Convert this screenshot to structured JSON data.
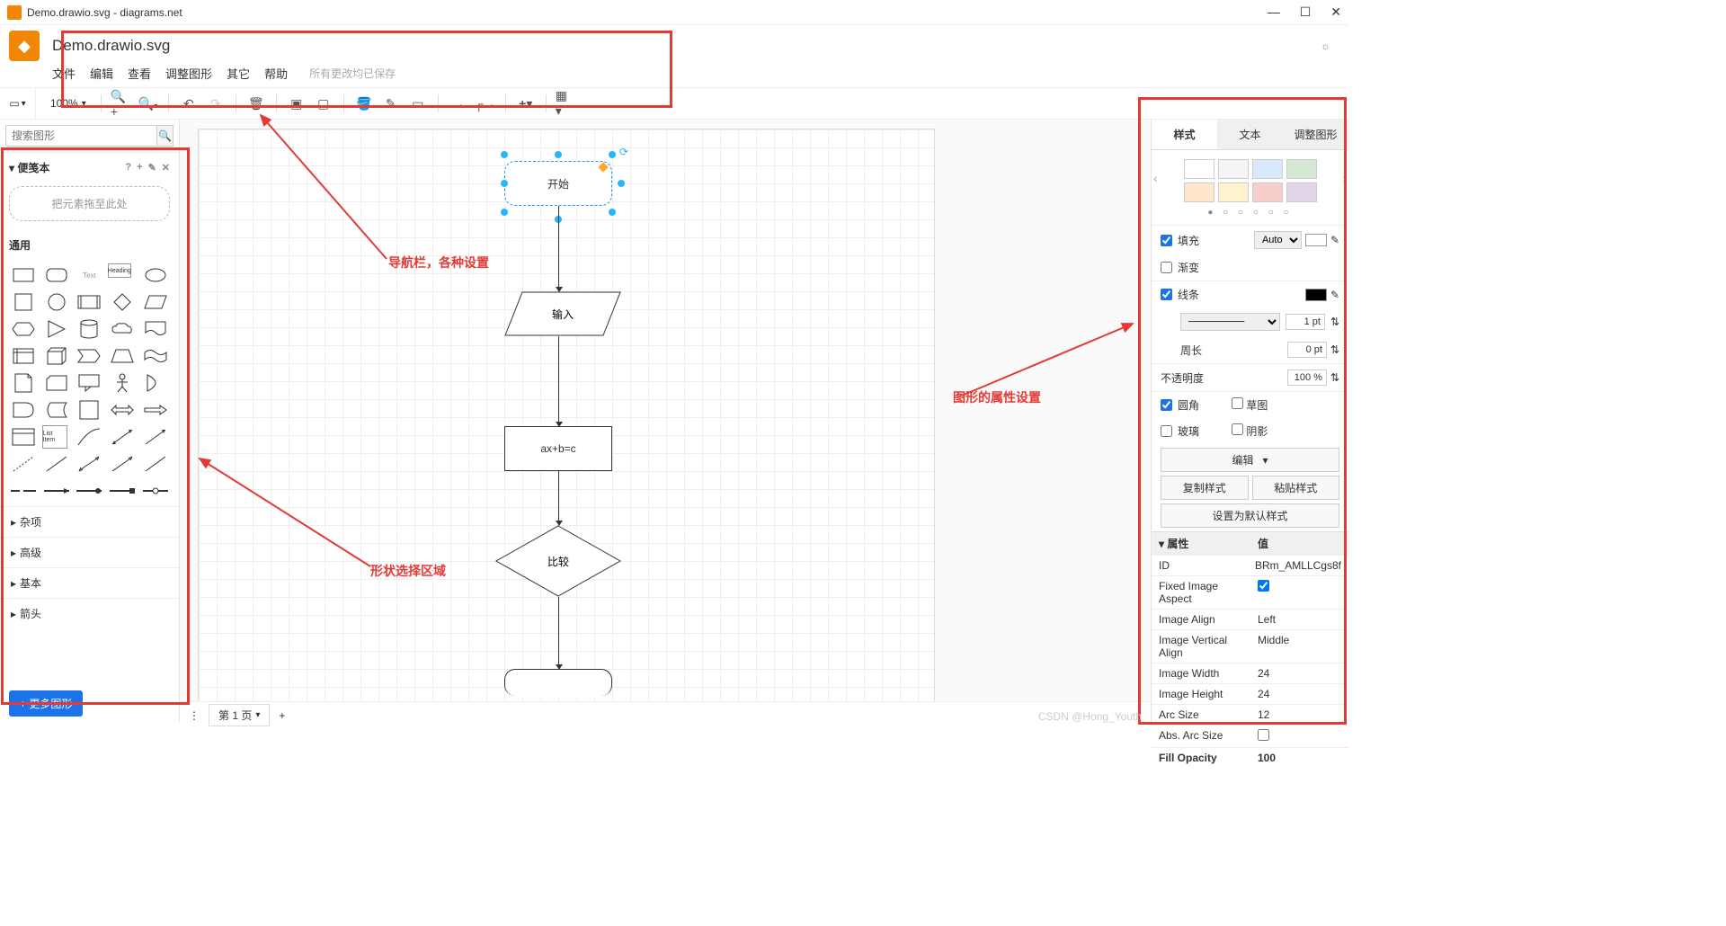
{
  "window": {
    "title": "Demo.drawio.svg - diagrams.net"
  },
  "header": {
    "filename": "Demo.drawio.svg"
  },
  "menu": {
    "file": "文件",
    "edit": "编辑",
    "view": "查看",
    "arrange": "调整图形",
    "extras": "其它",
    "help": "帮助",
    "saved": "所有更改均已保存"
  },
  "toolbar": {
    "zoom": "100%"
  },
  "left": {
    "search_placeholder": "搜索图形",
    "scratchpad": "便笺本",
    "scratchpad_help": "?",
    "dropzone": "把元素拖至此处",
    "general": "通用",
    "misc": "杂项",
    "advanced": "高级",
    "basic": "基本",
    "arrows": "箭头",
    "more": "+ 更多图形"
  },
  "canvas": {
    "start": "开始",
    "input": "输入",
    "process": "ax+b=c",
    "decision": "比较"
  },
  "right": {
    "tab_style": "样式",
    "tab_text": "文本",
    "tab_arrange": "调整图形",
    "fill": "填充",
    "fill_mode": "Auto",
    "gradient": "渐变",
    "line": "线条",
    "line_width": "1 pt",
    "perimeter": "周长",
    "perimeter_val": "0 pt",
    "opacity": "不透明度",
    "opacity_val": "100 %",
    "rounded": "圆角",
    "sketch": "草图",
    "glass": "玻璃",
    "shadow": "阴影",
    "edit": "编辑",
    "copy_style": "复制样式",
    "paste_style": "粘贴样式",
    "set_default": "设置为默认样式",
    "prop_header": "属性",
    "val_header": "值",
    "props": {
      "id_k": "ID",
      "id_v": "BRm_AMLLCgs8f",
      "fia_k": "Fixed Image Aspect",
      "ia_k": "Image Align",
      "ia_v": "Left",
      "iva_k": "Image Vertical Align",
      "iva_v": "Middle",
      "iw_k": "Image Width",
      "iw_v": "24",
      "ih_k": "Image Height",
      "ih_v": "24",
      "as_k": "Arc Size",
      "as_v": "12",
      "aas_k": "Abs. Arc Size",
      "fo_k": "Fill Opacity",
      "fo_v": "100"
    }
  },
  "bottom": {
    "page1": "第 1 页"
  },
  "annotations": {
    "nav": "导航栏，各种设置",
    "shapes": "形状选择区域",
    "props": "图形的属性设置"
  },
  "watermark": "CSDN @Hong_Youth"
}
